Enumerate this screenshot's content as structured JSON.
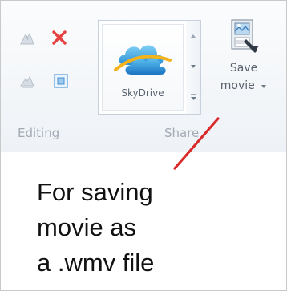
{
  "ribbon": {
    "editing": {
      "label": "Editing",
      "icons": [
        "trim-icon",
        "delete-icon",
        "rotate-icon",
        "select-all-icon"
      ]
    },
    "share": {
      "label": "Share",
      "gallery": {
        "items": [
          {
            "label": "SkyDrive",
            "icon": "skydrive-icon"
          }
        ]
      },
      "save_movie": {
        "line1": "Save",
        "line2": "movie",
        "icon": "save-movie-icon"
      }
    }
  },
  "annotation": {
    "lines": [
      "For saving",
      "movie as",
      "a .wmv file"
    ],
    "arrow_color": "#d92b2b"
  }
}
